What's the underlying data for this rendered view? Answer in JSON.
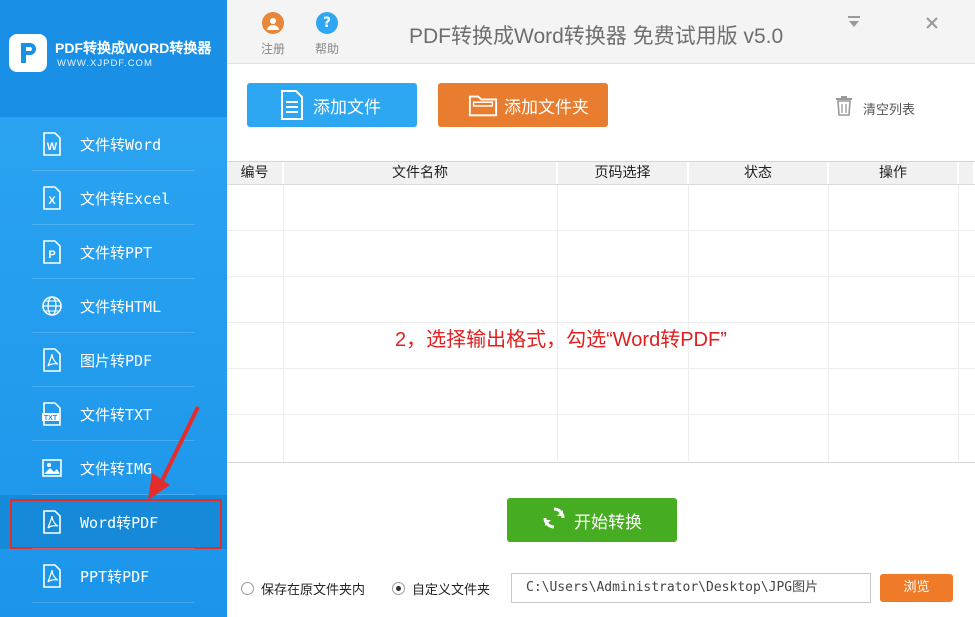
{
  "logo": {
    "title": "PDF转换成WORD转换器",
    "url": "WWW.XJPDF.COM"
  },
  "sidebar": {
    "items": [
      {
        "label": "文件转Word",
        "icon": "word-icon"
      },
      {
        "label": "文件转Excel",
        "icon": "excel-icon"
      },
      {
        "label": "文件转PPT",
        "icon": "ppt-icon"
      },
      {
        "label": "文件转HTML",
        "icon": "globe-icon"
      },
      {
        "label": "图片转PDF",
        "icon": "pdf-icon"
      },
      {
        "label": "文件转TXT",
        "icon": "txt-icon"
      },
      {
        "label": "文件转IMG",
        "icon": "image-icon"
      },
      {
        "label": "Word转PDF",
        "icon": "pdf-icon",
        "active": true
      },
      {
        "label": "PPT转PDF",
        "icon": "pdf-icon"
      }
    ]
  },
  "toolbar": {
    "register_label": "注册",
    "help_label": "帮助"
  },
  "app_title": "PDF转换成Word转换器 免费试用版 v5.0",
  "actions": {
    "add_file": "添加文件",
    "add_folder": "添加文件夹",
    "clear_list": "清空列表"
  },
  "table": {
    "headers": [
      "编号",
      "文件名称",
      "页码选择",
      "状态",
      "操作"
    ]
  },
  "instruction": "2，选择输出格式，勾选“Word转PDF”",
  "start_button": "开始转换",
  "output": {
    "option_original": "保存在原文件夹内",
    "option_custom": "自定义文件夹",
    "path": "C:\\Users\\Administrator\\Desktop\\JPG图片",
    "browse": "浏览"
  },
  "colors": {
    "sidebar": "#1d97ec",
    "add_file": "#2da7f1",
    "add_folder": "#e87c2f",
    "start": "#46ad22",
    "browse": "#ef7b28",
    "highlight": "#e32d2d"
  }
}
